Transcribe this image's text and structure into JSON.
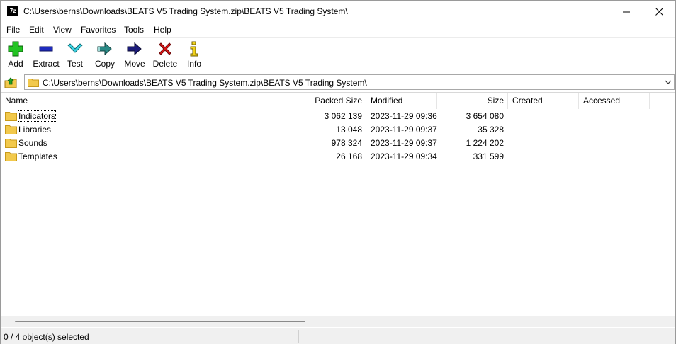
{
  "window": {
    "title": "C:\\Users\\berns\\Downloads\\BEATS V5 Trading System.zip\\BEATS V5 Trading System\\",
    "app_icon_text": "7z"
  },
  "menu": [
    "File",
    "Edit",
    "View",
    "Favorites",
    "Tools",
    "Help"
  ],
  "toolbar": [
    {
      "label": "Add",
      "icon": "add-icon"
    },
    {
      "label": "Extract",
      "icon": "extract-icon"
    },
    {
      "label": "Test",
      "icon": "test-icon"
    },
    {
      "label": "Copy",
      "icon": "copy-icon"
    },
    {
      "label": "Move",
      "icon": "move-icon"
    },
    {
      "label": "Delete",
      "icon": "delete-icon"
    },
    {
      "label": "Info",
      "icon": "info-icon"
    }
  ],
  "address": {
    "path": "C:\\Users\\berns\\Downloads\\BEATS V5 Trading System.zip\\BEATS V5 Trading System\\"
  },
  "columns": [
    "Name",
    "Packed Size",
    "Modified",
    "Size",
    "Created",
    "Accessed"
  ],
  "rows": [
    {
      "name": "Indicators",
      "packed": "3 062 139",
      "modified": "2023-11-29 09:36",
      "size": "3 654 080",
      "created": "",
      "accessed": ""
    },
    {
      "name": "Libraries",
      "packed": "13 048",
      "modified": "2023-11-29 09:37",
      "size": "35 328",
      "created": "",
      "accessed": ""
    },
    {
      "name": "Sounds",
      "packed": "978 324",
      "modified": "2023-11-29 09:37",
      "size": "1 224 202",
      "created": "",
      "accessed": ""
    },
    {
      "name": "Templates",
      "packed": "26 168",
      "modified": "2023-11-29 09:34",
      "size": "331 599",
      "created": "",
      "accessed": ""
    }
  ],
  "status": {
    "text": "0 / 4 object(s) selected"
  },
  "colors": {
    "add_green": "#22c322",
    "extract_blue": "#1f2bbf",
    "test_cyan": "#3cd6e6",
    "copy_teal": "#2a8a86",
    "move_navy": "#1c1c7a",
    "delete_red": "#e01515",
    "info_yellow": "#f1d21a",
    "folder_yellow": "#f2c94c"
  }
}
